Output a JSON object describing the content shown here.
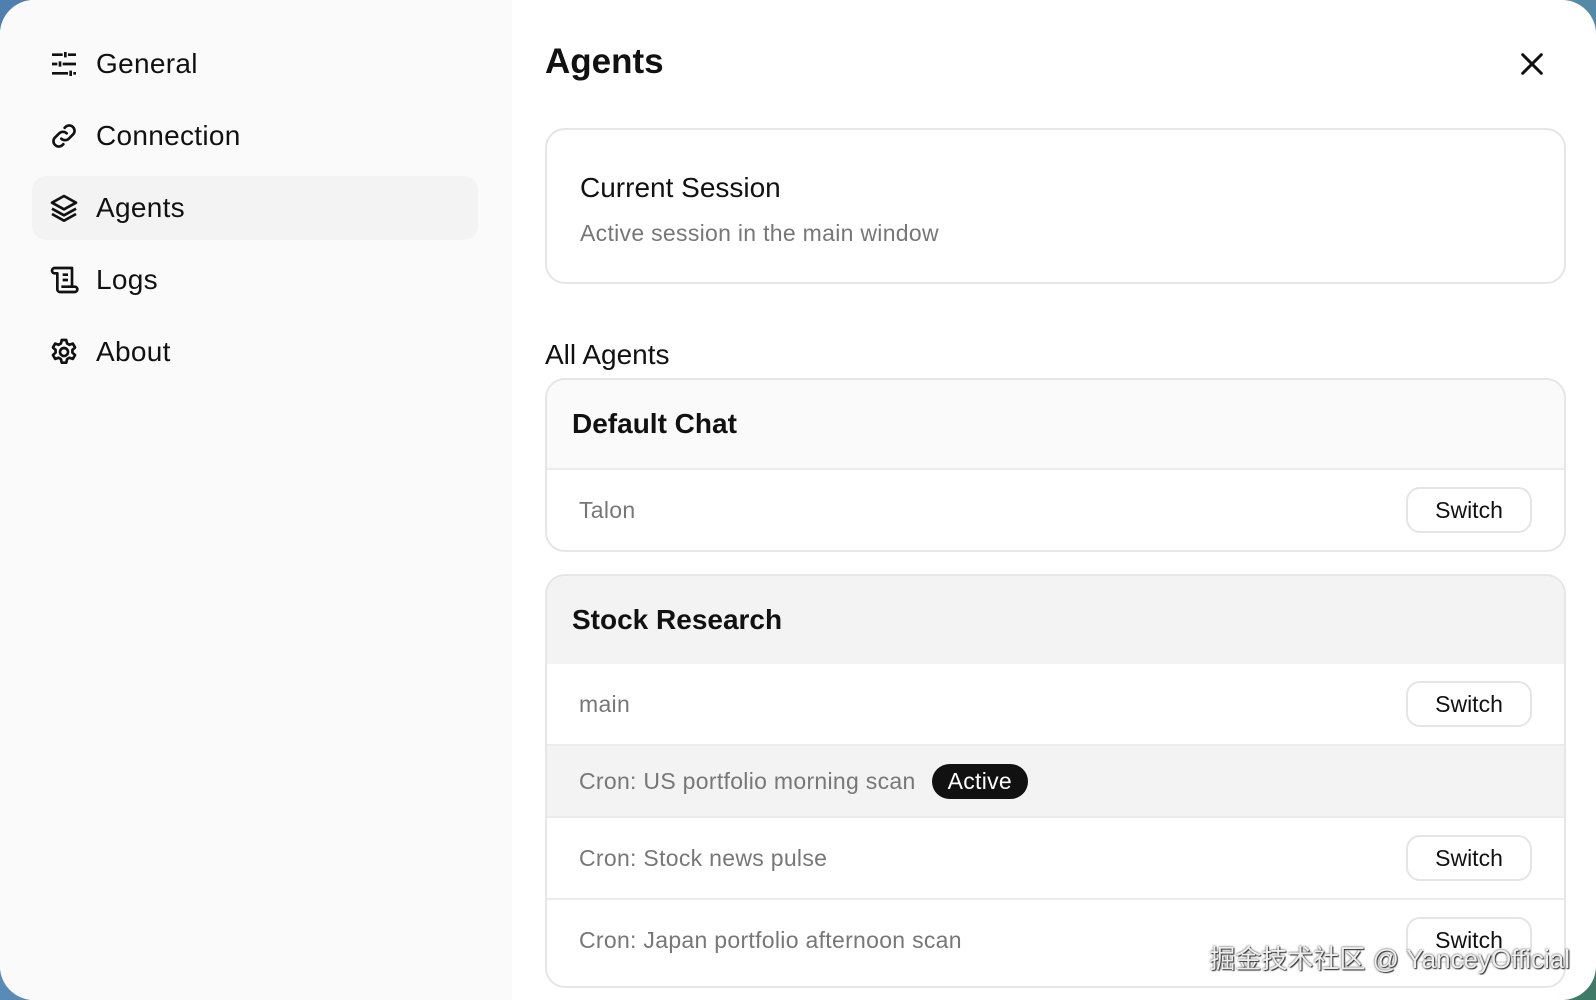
{
  "sidebar": {
    "items": [
      {
        "label": "General",
        "icon": "sliders-icon"
      },
      {
        "label": "Connection",
        "icon": "link-icon"
      },
      {
        "label": "Agents",
        "icon": "layers-icon",
        "active": true
      },
      {
        "label": "Logs",
        "icon": "scroll-icon"
      },
      {
        "label": "About",
        "icon": "gear-icon"
      }
    ]
  },
  "main": {
    "title": "Agents",
    "current_session": {
      "title": "Current Session",
      "subtitle": "Active session in the main window"
    },
    "all_agents_label": "All Agents",
    "groups": [
      {
        "name": "Default Chat",
        "rows": [
          {
            "label": "Talon",
            "action": "Switch"
          }
        ]
      },
      {
        "name": "Stock Research",
        "rows": [
          {
            "label": "main",
            "action": "Switch"
          },
          {
            "label": "Cron: US portfolio morning scan",
            "badge": "Active"
          },
          {
            "label": "Cron: Stock news pulse",
            "action": "Switch"
          },
          {
            "label": "Cron: Japan portfolio afternoon scan",
            "action": "Switch"
          }
        ]
      }
    ]
  },
  "watermark": "掘金技术社区 @ YanceyOfficial"
}
